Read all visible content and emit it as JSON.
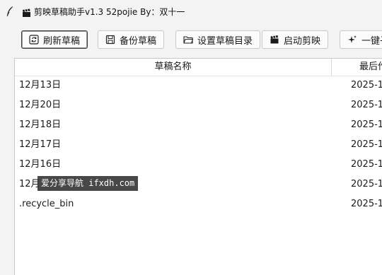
{
  "window": {
    "title": "剪映草稿助手v1.3  52pojie By：双十一"
  },
  "toolbar": {
    "refresh_label": "刷新草稿",
    "backup_label": "备份草稿",
    "set_dir_label": "设置草稿目录",
    "launch_label": "启动剪映",
    "oneclick_label": "一键子"
  },
  "table": {
    "headers": {
      "name": "草稿名称",
      "time": "最后作"
    },
    "rows": [
      {
        "name": "12月13日",
        "time": "2025-1"
      },
      {
        "name": "12月20日",
        "time": "2025-1"
      },
      {
        "name": "12月18日",
        "time": "2025-1"
      },
      {
        "name": "12月17日",
        "time": "2025-1"
      },
      {
        "name": "12月16日",
        "time": "2025-1"
      },
      {
        "name": "12月",
        "time": "2025-1"
      },
      {
        "name": ".recycle_bin",
        "time": "2025-1"
      }
    ]
  },
  "watermark": {
    "text": "爱分享导航 ifxdh.com"
  },
  "icons": {
    "app": "feather-icon",
    "title": "clapperboard-icon",
    "refresh": "refresh-icon",
    "backup": "save-icon",
    "set_dir": "folder-icon",
    "launch": "clapperboard-icon",
    "oneclick": "sparkle-icon"
  }
}
